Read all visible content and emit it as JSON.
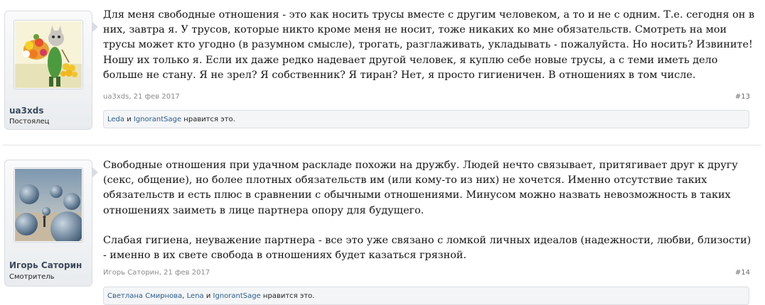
{
  "posts": [
    {
      "username": "ua3xds",
      "usertitle": "Постоялец",
      "avatar": "avatar-cat-flowers",
      "paragraphs": [
        "Для меня свободные отношения - это как носить трусы вместе с другим человеком, а то и не с одним. Т.е. сегодня он в них, завтра я. У трусов, которые никто кроме меня не носит, тоже никаких ко мне обязательств. Смотреть на мои трусы может кто угодно (в разумном смысле), трогать, разглаживать, укладывать - пожалуйста. Но носить? Извините! Ношу их только я. Если их даже редко надевает другой человек, я куплю себе новые трусы, а с теми иметь дело больше не стану. Я не зрел? Я собственник? Я тиран? Нет, я просто гигиеничен. В отношениях в том числе."
      ],
      "meta_author": "ua3xds",
      "meta_sep": ", ",
      "meta_date": "21 фев 2017",
      "post_number": "#13",
      "likes": {
        "users": [
          "Leda",
          "IgnorantSage"
        ],
        "joiners": [
          " и "
        ],
        "suffix": " нравится это."
      }
    },
    {
      "username": "Игорь Саторин",
      "usertitle": "Смотритель",
      "avatar": "avatar-surreal-spheres",
      "paragraphs": [
        "Свободные отношения при удачном раскладе похожи на дружбу. Людей нечто связывает, притягивает друг к другу (секс, общение), но более плотных обязательств им (или кому-то из них) не хочется. Именно отсутствие таких обязательств и есть плюс в сравнении с обычными отношениями. Минусом можно назвать невозможность в таких отношениях заиметь в лице партнера опору для будущего.",
        "Слабая гигиена, неуважение партнера - все это уже связано с ломкой личных идеалов (надежности, любви, близости) - именно в их свете свобода в отношениях будет казаться грязной."
      ],
      "meta_author": "Игорь Саторин",
      "meta_sep": ", ",
      "meta_date": "21 фев 2017",
      "post_number": "#14",
      "likes": {
        "users": [
          "Светлана Смирнова",
          "Lena",
          "IgnorantSage"
        ],
        "joiners": [
          ", ",
          " и "
        ],
        "suffix": " нравится это."
      }
    }
  ]
}
